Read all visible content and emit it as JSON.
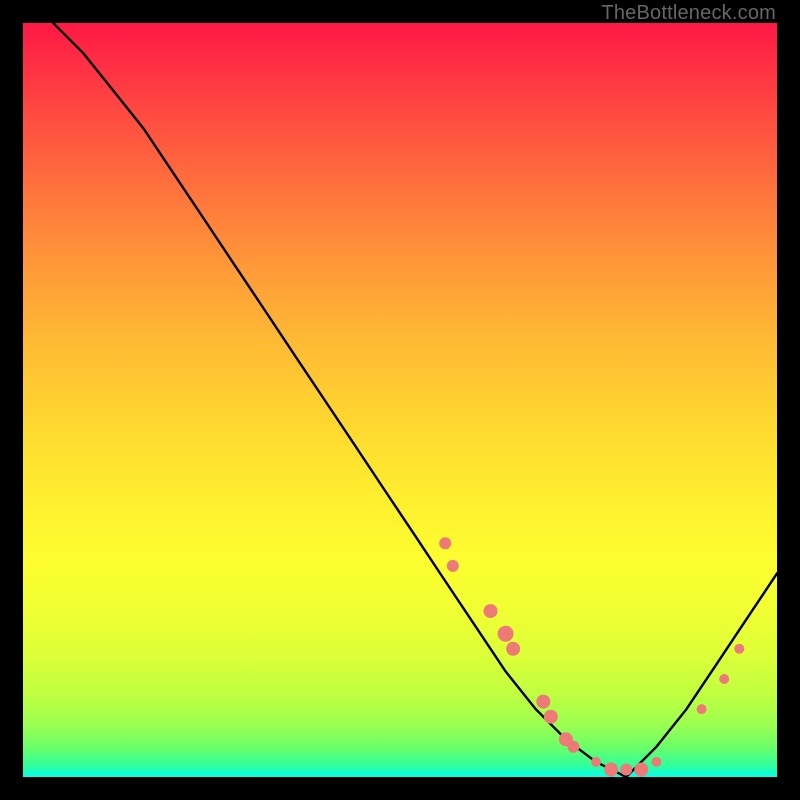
{
  "attribution": "TheBottleneck.com",
  "chart_data": {
    "type": "line",
    "title": "",
    "xlabel": "",
    "ylabel": "",
    "xlim": [
      0,
      100
    ],
    "ylim": [
      0,
      100
    ],
    "grid": false,
    "background": "red-yellow-green vertical gradient (heatmap-like)",
    "series": [
      {
        "name": "curve",
        "stroke": "#000000",
        "x": [
          4,
          8,
          12,
          16,
          20,
          24,
          28,
          32,
          36,
          40,
          44,
          48,
          52,
          56,
          60,
          64,
          68,
          72,
          76,
          80,
          84,
          88,
          92,
          96,
          100
        ],
        "y": [
          100,
          96,
          91,
          86,
          80,
          74,
          68,
          62,
          56,
          50,
          44,
          38,
          32,
          26,
          20,
          14,
          9,
          5,
          2,
          0,
          4,
          9,
          15,
          21,
          27
        ]
      }
    ],
    "markers": [
      {
        "x": 56,
        "y": 31,
        "r": 6,
        "color": "#ed7a77"
      },
      {
        "x": 57,
        "y": 28,
        "r": 6,
        "color": "#ed7a77"
      },
      {
        "x": 62,
        "y": 22,
        "r": 7,
        "color": "#ed7a77"
      },
      {
        "x": 64,
        "y": 19,
        "r": 8,
        "color": "#ed7a77"
      },
      {
        "x": 65,
        "y": 17,
        "r": 7,
        "color": "#ed7a77"
      },
      {
        "x": 69,
        "y": 10,
        "r": 7,
        "color": "#ed7a77"
      },
      {
        "x": 70,
        "y": 8,
        "r": 7,
        "color": "#ed7a77"
      },
      {
        "x": 72,
        "y": 5,
        "r": 7,
        "color": "#ed7a77"
      },
      {
        "x": 73,
        "y": 4,
        "r": 6,
        "color": "#ed7a77"
      },
      {
        "x": 76,
        "y": 2,
        "r": 5,
        "color": "#ed7a77"
      },
      {
        "x": 78,
        "y": 1,
        "r": 7,
        "color": "#ed7a77"
      },
      {
        "x": 80,
        "y": 1,
        "r": 6,
        "color": "#ed7a77"
      },
      {
        "x": 82,
        "y": 1,
        "r": 7,
        "color": "#ed7a77"
      },
      {
        "x": 84,
        "y": 2,
        "r": 5,
        "color": "#ed7a77"
      },
      {
        "x": 90,
        "y": 9,
        "r": 5,
        "color": "#ed7a77"
      },
      {
        "x": 93,
        "y": 13,
        "r": 5,
        "color": "#ed7a77"
      },
      {
        "x": 95,
        "y": 17,
        "r": 5,
        "color": "#ed7a77"
      }
    ]
  }
}
